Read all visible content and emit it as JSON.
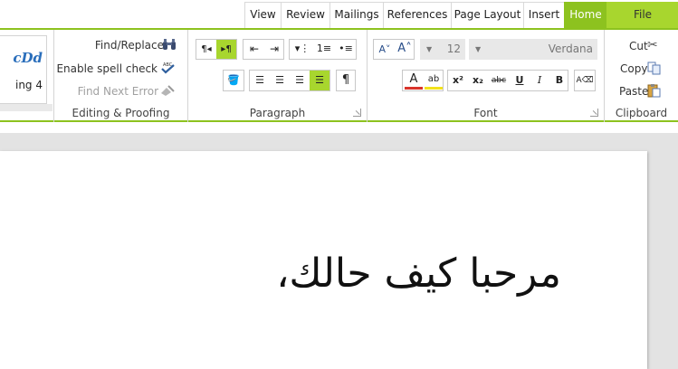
{
  "tabs": [
    {
      "label": "View"
    },
    {
      "label": "Review"
    },
    {
      "label": "Mailings"
    },
    {
      "label": "References"
    },
    {
      "label": "Page Layout"
    },
    {
      "label": "Insert"
    },
    {
      "label": "Home"
    },
    {
      "label": "File"
    }
  ],
  "styles": {
    "sample": "cDd",
    "name": "ing 4"
  },
  "editing": {
    "find_replace": "Find/Replace",
    "spell_check": "Enable spell check",
    "find_next": "Find Next Error",
    "label": "Editing & Proofing"
  },
  "paragraph": {
    "label": "Paragraph"
  },
  "font": {
    "label": "Font",
    "size": "12",
    "family": "Verdana",
    "superscript": "x²",
    "subscript": "x₂",
    "strike": "abc",
    "underline": "U",
    "italic": "I",
    "bold": "B"
  },
  "clipboard": {
    "cut": "Cut",
    "copy": "Copy",
    "paste": "Paste",
    "label": "Clipboard"
  },
  "document": {
    "text": "مرحبا كيف حالك،"
  },
  "colors": {
    "accent": "#8dc21f",
    "file_tab": "#a8d62e"
  }
}
